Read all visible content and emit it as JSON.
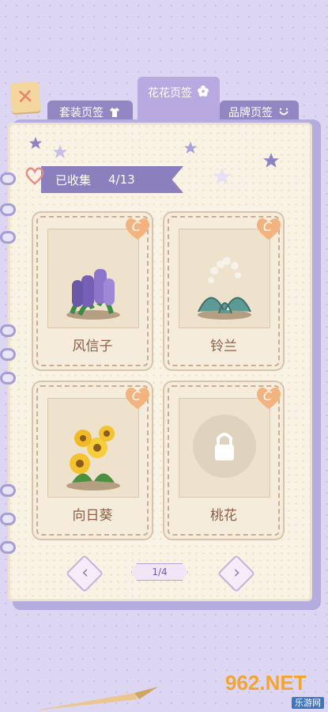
{
  "tabs": {
    "outfit": "套装页签",
    "flower": "花花页签",
    "brand": "品牌页签"
  },
  "collection": {
    "label": "已收集",
    "count": "4/13"
  },
  "cards": [
    {
      "name": "风信子",
      "badge": "C",
      "locked": false
    },
    {
      "name": "铃兰",
      "badge": "C",
      "locked": false
    },
    {
      "name": "向日葵",
      "badge": "C",
      "locked": false
    },
    {
      "name": "桃花",
      "badge": "C",
      "locked": true
    }
  ],
  "pager": {
    "text": "1/4",
    "prev": "‹",
    "next": "›"
  },
  "close": {
    "label": "✕"
  },
  "watermark": {
    "main": "962.NET",
    "sub": "乐游网"
  }
}
